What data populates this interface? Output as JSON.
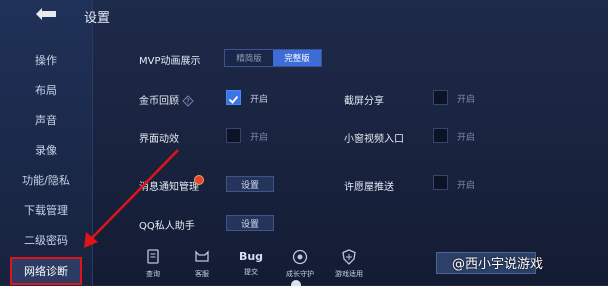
{
  "header": {
    "title": "设置"
  },
  "sidebar": {
    "items": [
      {
        "label": ""
      },
      {
        "label": "操作"
      },
      {
        "label": "布局"
      },
      {
        "label": "声音"
      },
      {
        "label": "录像"
      },
      {
        "label": "功能/隐私"
      },
      {
        "label": "下载管理"
      },
      {
        "label": "二级密码"
      },
      {
        "label": "网络诊断"
      }
    ],
    "active_index": 8
  },
  "settings": {
    "mvp": {
      "label": "MVP动画展示",
      "options": [
        "精简版",
        "完整版"
      ],
      "selected": "完整版"
    },
    "coin": {
      "label": "金币回顾",
      "state": "开启"
    },
    "screen_share": {
      "label": "截屏分享",
      "state": "开启"
    },
    "interface_fx": {
      "label": "界面动效",
      "state": "开启"
    },
    "small_video": {
      "label": "小窗视频入口",
      "state": "开启"
    },
    "notify": {
      "label": "消息通知管理",
      "button": "设置"
    },
    "wish_push": {
      "label": "许愿屋推送",
      "state": "开启"
    },
    "qq_assistant": {
      "label": "QQ私人助手",
      "button": "设置"
    }
  },
  "bottom_bar": {
    "items": [
      {
        "icon": "query-icon",
        "label": "查询"
      },
      {
        "icon": "service-icon",
        "label": "客服"
      },
      {
        "icon": "bug-icon",
        "title": "Bug",
        "label": "提交"
      },
      {
        "icon": "guard-icon",
        "label": "成长守护"
      },
      {
        "icon": "shield-icon",
        "label": "游戏适用"
      }
    ]
  },
  "watermark": "@西小宇说游戏",
  "colors": {
    "accent": "#3d6bd8",
    "highlight": "#e0121a",
    "checked": "#3a74e6"
  }
}
